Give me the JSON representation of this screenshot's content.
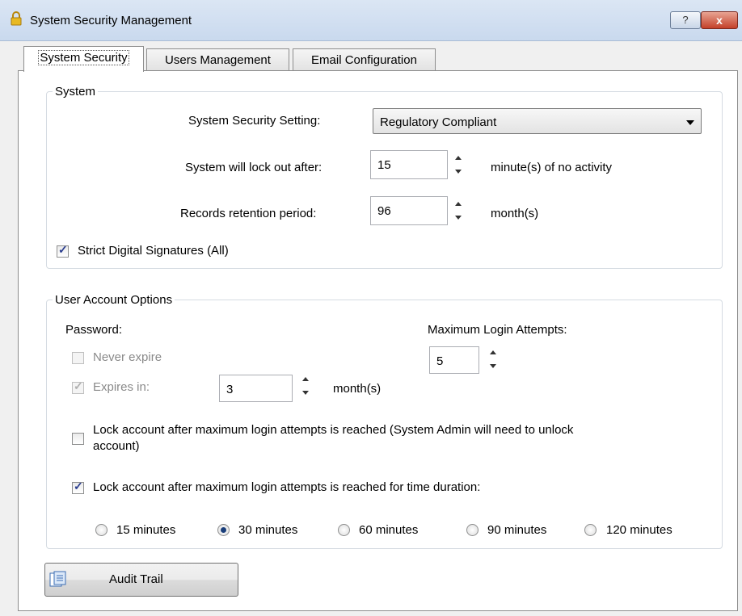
{
  "window": {
    "title": "System Security Management",
    "help_label": "?",
    "close_label": "x"
  },
  "tabs": [
    {
      "label": "System Security",
      "active": true
    },
    {
      "label": "Users Management",
      "active": false
    },
    {
      "label": "Email Configuration",
      "active": false
    }
  ],
  "system": {
    "title": "System",
    "security_setting_label": "System Security Setting:",
    "security_setting_value": "Regulatory Compliant",
    "lockout_label": "System will lock out after:",
    "lockout_value": "15",
    "lockout_unit": "minute(s) of no activity",
    "retention_label": "Records retention period:",
    "retention_value": "96",
    "retention_unit": "month(s)",
    "strict_signatures_label": "Strict Digital Signatures (All)",
    "strict_signatures_checked": true
  },
  "user_account": {
    "title": "User Account Options",
    "password_label": "Password:",
    "never_expire_label": "Never expire",
    "never_expire_checked": false,
    "expires_in_label": "Expires in:",
    "expires_in_checked": true,
    "expires_in_value": "3",
    "expires_in_unit": "month(s)",
    "max_attempts_label": "Maximum Login Attempts:",
    "max_attempts_value": "5",
    "lock_admin_label_line1": "Lock account after maximum login attempts is reached (System Admin will need to unlock",
    "lock_admin_label_line2": "account)",
    "lock_admin_checked": false,
    "lock_duration_label": "Lock account after maximum login attempts is reached for time duration:",
    "lock_duration_checked": true,
    "duration_options": [
      {
        "label": "15 minutes",
        "selected": false
      },
      {
        "label": "30 minutes",
        "selected": true
      },
      {
        "label": "60 minutes",
        "selected": false
      },
      {
        "label": "90 minutes",
        "selected": false
      },
      {
        "label": "120 minutes",
        "selected": false
      }
    ]
  },
  "audit_trail_label": "Audit Trail",
  "icons": {
    "app": "lock-icon",
    "audit": "document-list-icon"
  },
  "colors": {
    "title_bar": "#c9d9ee",
    "close_button": "#c4412a",
    "check_mark": "#2a3d8f"
  }
}
